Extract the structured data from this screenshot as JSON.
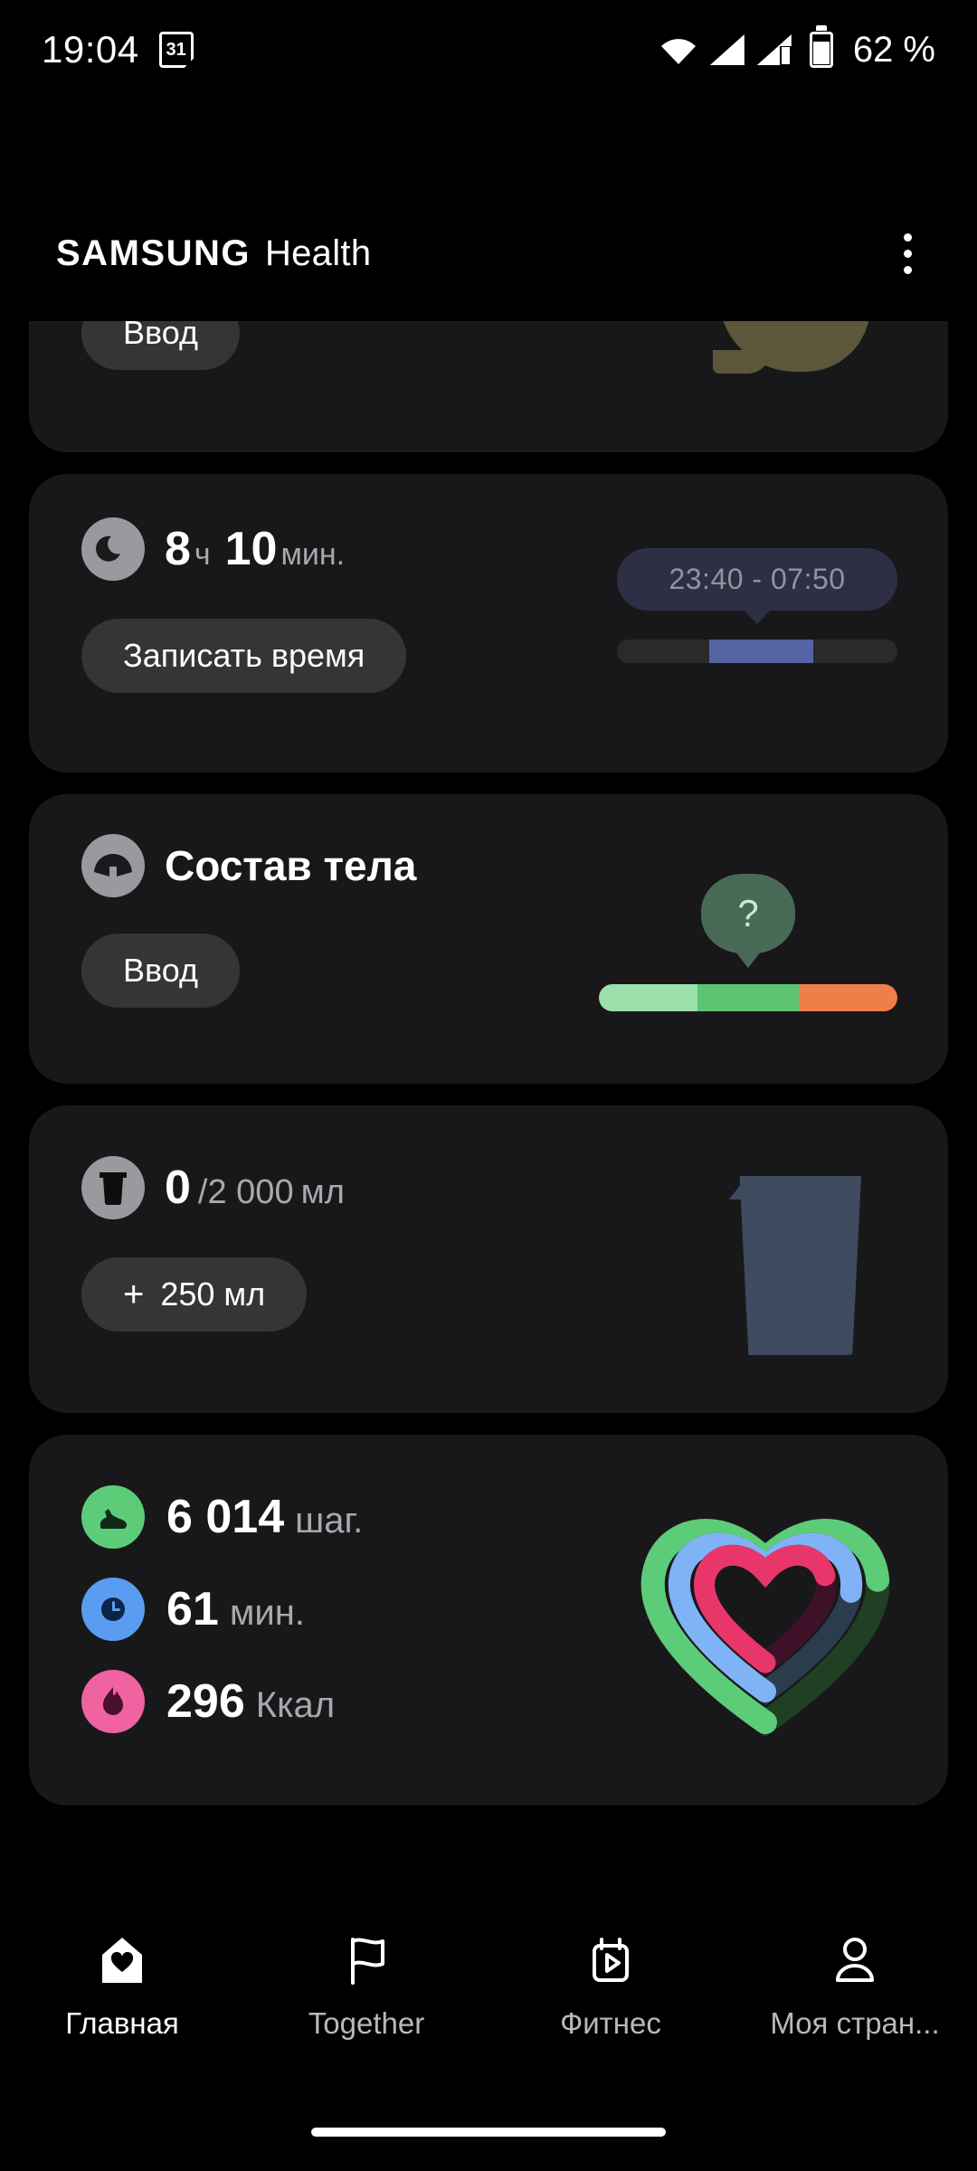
{
  "status_bar": {
    "time": "19:04",
    "calendar_day": "31",
    "battery_text": "62 %",
    "icons": [
      "calendar-icon",
      "wifi-icon",
      "signal-icon",
      "signal-icon",
      "battery-icon"
    ]
  },
  "header": {
    "brand_primary": "SAMSUNG",
    "brand_secondary": "Health",
    "menu_icon": "more-options-icon"
  },
  "cards": {
    "food_partial": {
      "button_label": "Ввод",
      "illustration_color": "#5c573b"
    },
    "sleep": {
      "icon": "moon-icon",
      "hours_value": "8",
      "hours_unit": "ч",
      "minutes_value": "10",
      "minutes_unit": "мин.",
      "button_label": "Записать время",
      "tooltip": "23:40 - 07:50",
      "bar_fill_color": "#5463a3",
      "bar_track_color": "#2a2a2c",
      "bar_offset_pct": 33,
      "bar_width_pct": 37
    },
    "body_composition": {
      "icon": "body-scale-icon",
      "title": "Состав тела",
      "button_label": "Ввод",
      "tooltip": "?",
      "tooltip_color": "#4a6a58",
      "segments": [
        {
          "color": "#9ce0ab",
          "width_pct": 33
        },
        {
          "color": "#5cc472",
          "width_pct": 34
        },
        {
          "color": "#ef7f48",
          "width_pct": 33
        }
      ]
    },
    "water": {
      "icon": "water-cup-icon",
      "current": "0",
      "separator": "/2 000",
      "unit": "мл",
      "button_plus": "+",
      "button_label": "250 мл",
      "glass_color": "#3e4a5e"
    },
    "activity": {
      "rows": [
        {
          "icon": "shoe-icon",
          "icon_color": "#5dcc78",
          "value": "6 014",
          "unit": "шаг."
        },
        {
          "icon": "clock-icon",
          "icon_color": "#5a9cf0",
          "value": "61",
          "unit": "мин."
        },
        {
          "icon": "flame-icon",
          "icon_color": "#f062a0",
          "value": "296",
          "unit": "Ккал"
        }
      ],
      "rings": {
        "steps_color": "#5dcc78",
        "steps_track": "#1f4023",
        "active_color": "#7fb3f5",
        "active_track": "#2b3c4d",
        "calories_color": "#e8366b",
        "calories_track": "#3d1228"
      }
    }
  },
  "bottom_nav": {
    "items": [
      {
        "label": "Главная",
        "icon": "home-heart-icon",
        "active": true
      },
      {
        "label": "Together",
        "icon": "flag-icon",
        "active": false
      },
      {
        "label": "Фитнес",
        "icon": "fitness-video-icon",
        "active": false
      },
      {
        "label": "Моя стран...",
        "icon": "person-icon",
        "active": false
      }
    ]
  }
}
